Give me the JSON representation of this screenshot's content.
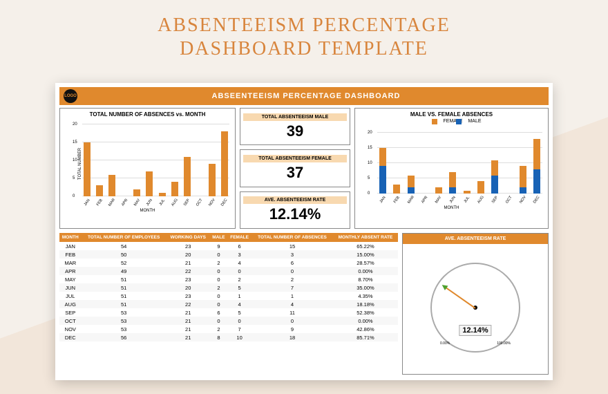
{
  "page_title_line1": "ABSENTEEISM PERCENTAGE",
  "page_title_line2": "DASHBOARD TEMPLATE",
  "logo_text": "LOGO",
  "header": "ABSEENTEEISM PERCENTAGE DASHBOARD",
  "left_chart_title": "TOTAL NUMBER OF ABSENCES vs. MONTH",
  "right_chart_title": "MALE VS. FEMALE ABSENCES",
  "y_axis_label": "TOTAL NUMBER",
  "x_axis_label": "MONTH",
  "legend_female": "FEMALE",
  "legend_male": "MALE",
  "kpi": [
    {
      "title": "TOTAL ABSENTEEISM MALE",
      "value": "39"
    },
    {
      "title": "TOTAL ABSENTEEISM FEMALE",
      "value": "37"
    },
    {
      "title": "AVE. ABSENTEEISM RATE",
      "value": "12.14%"
    }
  ],
  "table_headers": [
    "MONTH",
    "TOTAL NUMBER OF EMPLOYEES",
    "WORKING DAYS",
    "MALE",
    "FEMALE",
    "TOTAL NUMBER OF ABSENCES",
    "MONTHLY ABSENT RATE"
  ],
  "table_rows": [
    [
      "JAN",
      "54",
      "23",
      "9",
      "6",
      "15",
      "65.22%"
    ],
    [
      "FEB",
      "50",
      "20",
      "0",
      "3",
      "3",
      "15.00%"
    ],
    [
      "MAR",
      "52",
      "21",
      "2",
      "4",
      "6",
      "28.57%"
    ],
    [
      "APR",
      "49",
      "22",
      "0",
      "0",
      "0",
      "0.00%"
    ],
    [
      "MAY",
      "51",
      "23",
      "0",
      "2",
      "2",
      "8.70%"
    ],
    [
      "JUN",
      "51",
      "20",
      "2",
      "5",
      "7",
      "35.00%"
    ],
    [
      "JUL",
      "51",
      "23",
      "0",
      "1",
      "1",
      "4.35%"
    ],
    [
      "AUG",
      "51",
      "22",
      "0",
      "4",
      "4",
      "18.18%"
    ],
    [
      "SEP",
      "53",
      "21",
      "6",
      "5",
      "11",
      "52.38%"
    ],
    [
      "OCT",
      "53",
      "21",
      "0",
      "0",
      "0",
      "0.00%"
    ],
    [
      "NOV",
      "53",
      "21",
      "2",
      "7",
      "9",
      "42.86%"
    ],
    [
      "DEC",
      "56",
      "21",
      "8",
      "10",
      "18",
      "85.71%"
    ]
  ],
  "gauge_title": "AVE. ABSENTEEISM RATE",
  "gauge_value": "12.14%",
  "gauge_scale_min": "0.00%",
  "gauge_scale_max": "100.00%",
  "chart_data": [
    {
      "type": "bar",
      "title": "TOTAL NUMBER OF ABSENCES vs. MONTH",
      "xlabel": "MONTH",
      "ylabel": "TOTAL NUMBER",
      "ylim": [
        0,
        20
      ],
      "categories": [
        "JAN",
        "FEB",
        "MAR",
        "APR",
        "MAY",
        "JUN",
        "JUL",
        "AUG",
        "SEP",
        "OCT",
        "NOV",
        "DEC"
      ],
      "values": [
        15,
        3,
        6,
        0,
        2,
        7,
        1,
        4,
        11,
        0,
        9,
        18
      ]
    },
    {
      "type": "bar",
      "stacked": true,
      "title": "MALE VS. FEMALE ABSENCES",
      "xlabel": "MONTH",
      "ylabel": "TOTAL NUMBER",
      "ylim": [
        0,
        20
      ],
      "categories": [
        "JAN",
        "FEB",
        "MAR",
        "APR",
        "MAY",
        "JUN",
        "JUL",
        "AUG",
        "SEP",
        "OCT",
        "NOV",
        "DEC"
      ],
      "series": [
        {
          "name": "MALE",
          "color": "#1862b5",
          "values": [
            9,
            0,
            2,
            0,
            0,
            2,
            0,
            0,
            6,
            0,
            2,
            8
          ]
        },
        {
          "name": "FEMALE",
          "color": "#e0892d",
          "values": [
            6,
            3,
            4,
            0,
            2,
            5,
            1,
            4,
            5,
            0,
            7,
            10
          ]
        }
      ]
    },
    {
      "type": "gauge",
      "title": "AVE. ABSENTEEISM RATE",
      "value": 12.14,
      "min": 0,
      "max": 100,
      "display": "12.14%"
    }
  ]
}
